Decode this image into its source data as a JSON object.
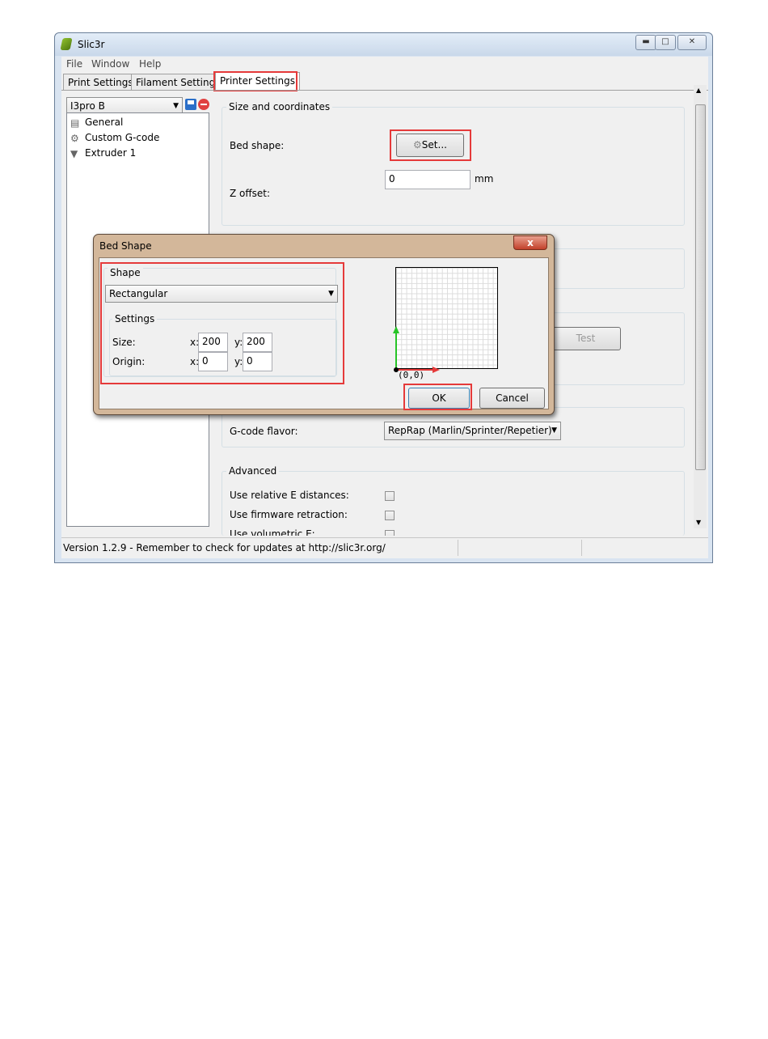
{
  "window": {
    "title": "Slic3r",
    "minimize_icon": "minimize-icon",
    "maximize_icon": "maximize-icon",
    "close_icon": "close-icon"
  },
  "menu": [
    "File",
    "Window",
    "Help"
  ],
  "tabs": [
    {
      "label": "Print Settings"
    },
    {
      "label": "Filament Settings"
    },
    {
      "label": "Printer Settings",
      "active": true
    }
  ],
  "preset": {
    "value": "I3pro B"
  },
  "tree": [
    {
      "label": "General",
      "icon": "printer-icon"
    },
    {
      "label": "Custom G-code",
      "icon": "gear-icon"
    },
    {
      "label": "Extruder 1",
      "icon": "funnel-icon"
    }
  ],
  "size_coords": {
    "title": "Size and coordinates",
    "bed_shape_label": "Bed shape:",
    "set_button": "Set...",
    "z_offset_label": "Z offset:",
    "z_offset_value": "0",
    "z_unit": "mm"
  },
  "test_button": "Test",
  "gcode": {
    "label": "G-code flavor:",
    "value": "RepRap (Marlin/Sprinter/Repetier)"
  },
  "advanced": {
    "title": "Advanced",
    "items": [
      "Use relative E distances:",
      "Use firmware retraction:",
      "Use volumetric E:"
    ]
  },
  "status": "Version 1.2.9 - Remember to check for updates at http://slic3r.org/",
  "dialog": {
    "title": "Bed Shape",
    "close": "x",
    "shape_title": "Shape",
    "shape_value": "Rectangular",
    "settings_title": "Settings",
    "size_label": "Size:",
    "origin_label": "Origin:",
    "x_prefix": "x:",
    "y_prefix": "y:",
    "size_x": "200",
    "size_y": "200",
    "origin_x": "0",
    "origin_y": "0",
    "preview_origin": "(0,0)",
    "ok": "OK",
    "cancel": "Cancel"
  },
  "colors": {
    "highlight": "#e53a3a",
    "y_axis": "#27c427",
    "x_axis": "#e53a3a"
  }
}
